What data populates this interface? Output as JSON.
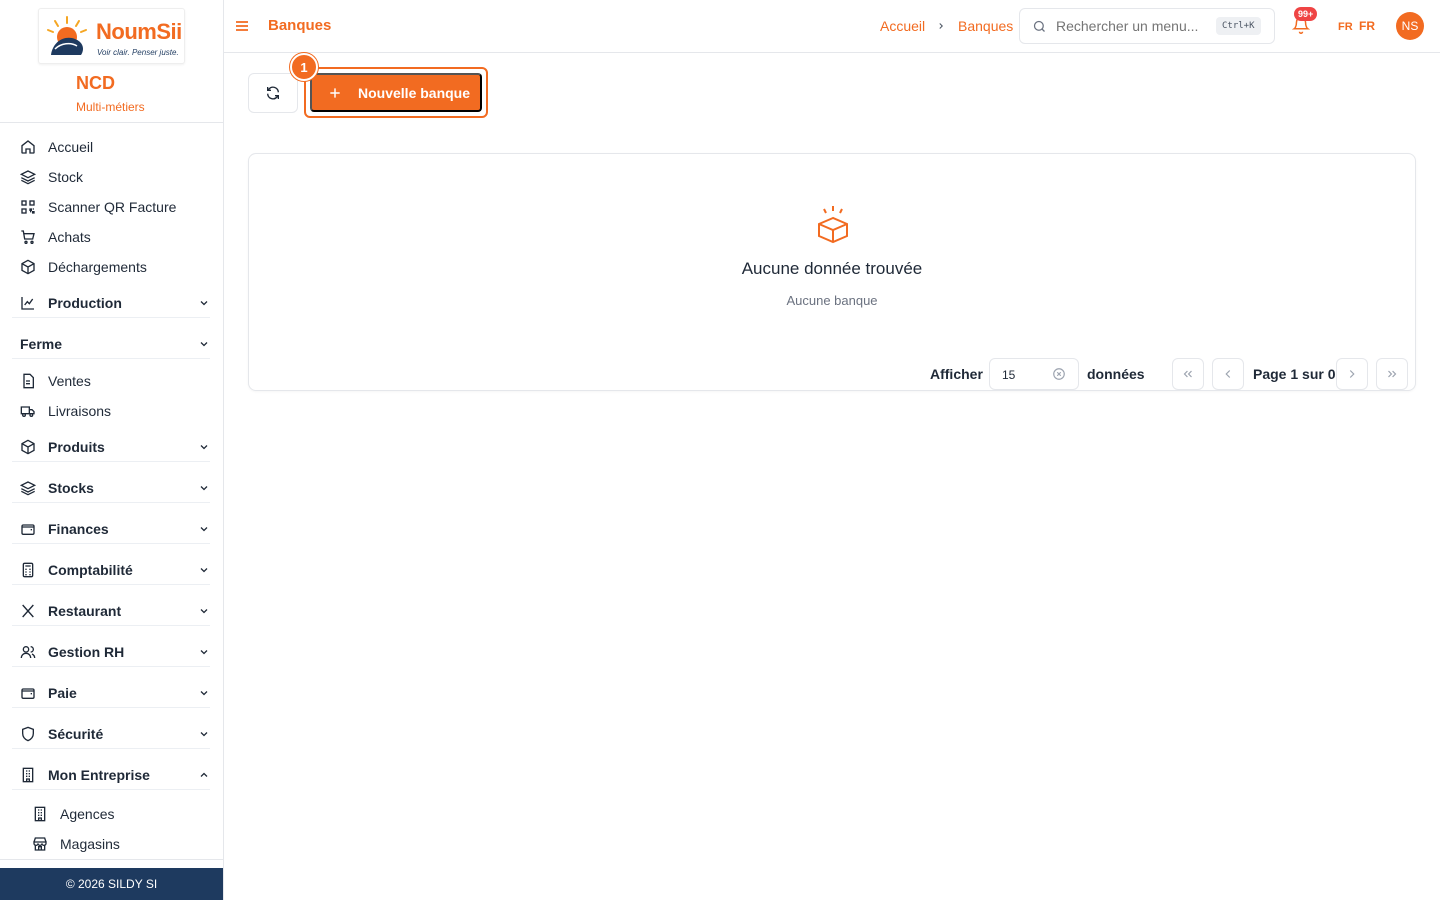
{
  "brand": {
    "logo_name": "NoumSii",
    "logo_tagline": "Voir clair. Penser juste.",
    "company_name": "NCD",
    "company_subtitle": "Multi-métiers",
    "accent_color": "#f26b21",
    "footer_color": "#1e3a5f"
  },
  "sidebar": {
    "items": [
      {
        "label": "Accueil",
        "icon": "home-icon"
      },
      {
        "label": "Stock",
        "icon": "layers-icon"
      },
      {
        "label": "Scanner QR Facture",
        "icon": "qr-icon"
      },
      {
        "label": "Achats",
        "icon": "cart-icon"
      },
      {
        "label": "Déchargements",
        "icon": "package-icon"
      }
    ],
    "groups": {
      "production": "Production",
      "ferme": "Ferme",
      "produits": "Produits",
      "stocks": "Stocks",
      "finances": "Finances",
      "comptabilite": "Comptabilité",
      "restaurant": "Restaurant",
      "gestion_rh": "Gestion RH",
      "paie": "Paie",
      "securite": "Sécurité",
      "mon_entreprise": "Mon Entreprise"
    },
    "ferme_items": [
      {
        "label": "Ventes",
        "icon": "file-icon"
      },
      {
        "label": "Livraisons",
        "icon": "truck-icon"
      }
    ],
    "entreprise_items": [
      {
        "label": "Agences",
        "icon": "building-icon"
      },
      {
        "label": "Magasins",
        "icon": "store-icon"
      }
    ],
    "footer": "© 2026 SILDY SI"
  },
  "topbar": {
    "page_title": "Banques",
    "breadcrumb": [
      "Accueil",
      "Banques"
    ],
    "search_placeholder": "Rechercher un menu...",
    "search_shortcut": "Ctrl+K",
    "notifications_badge": "99+",
    "lang_code": "FR",
    "lang_label": "FR",
    "avatar_initials": "NS"
  },
  "toolbar": {
    "new_button_label": "Nouvelle banque",
    "step_badge": "1"
  },
  "empty_state": {
    "title": "Aucune donnée trouvée",
    "subtitle": "Aucune banque"
  },
  "pagination": {
    "show_label": "Afficher",
    "per_page": "15",
    "data_label": "données",
    "page_text": "Page 1 sur 0"
  }
}
